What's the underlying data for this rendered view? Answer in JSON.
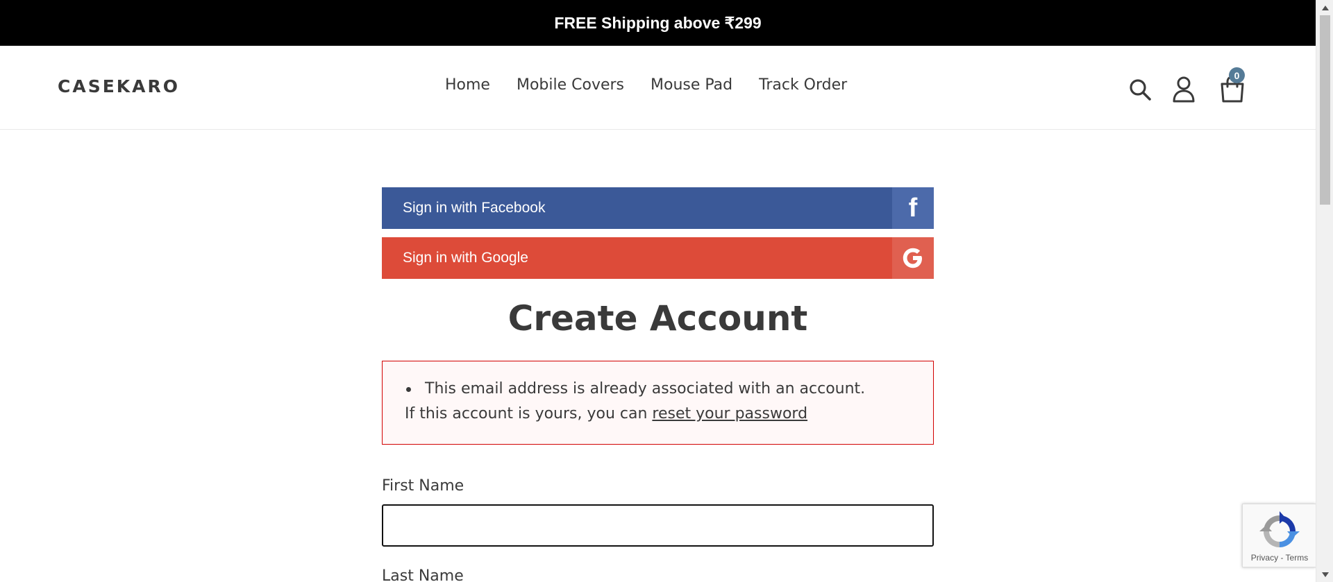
{
  "announcement": {
    "text": "FREE Shipping above ₹299"
  },
  "header": {
    "logo": "CASEKARO",
    "nav": [
      "Home",
      "Mobile Covers",
      "Mouse Pad",
      "Track Order"
    ],
    "icons": [
      "search-icon",
      "account-icon",
      "cart-icon"
    ],
    "cart_count": "0"
  },
  "social": {
    "facebook_label": "Sign in with Facebook",
    "facebook_badge": "f",
    "google_label": "Sign in with Google",
    "google_badge": "G"
  },
  "page": {
    "title": "Create Account"
  },
  "error": {
    "message": "This email address is already associated with an account.",
    "followup_prefix": "If this account is yours, you can",
    "followup_link": "reset your password"
  },
  "form": {
    "first_name_label": "First Name",
    "first_name_value": "",
    "last_name_label": "Last Name"
  },
  "recaptcha": {
    "terms": "Privacy - Terms"
  },
  "colors": {
    "announcement_bg": "#000000",
    "facebook": "#3b5998",
    "google": "#dd4b39",
    "error_border": "#d20000",
    "cart_badge": "#557b97",
    "text": "#3a3a3a"
  }
}
